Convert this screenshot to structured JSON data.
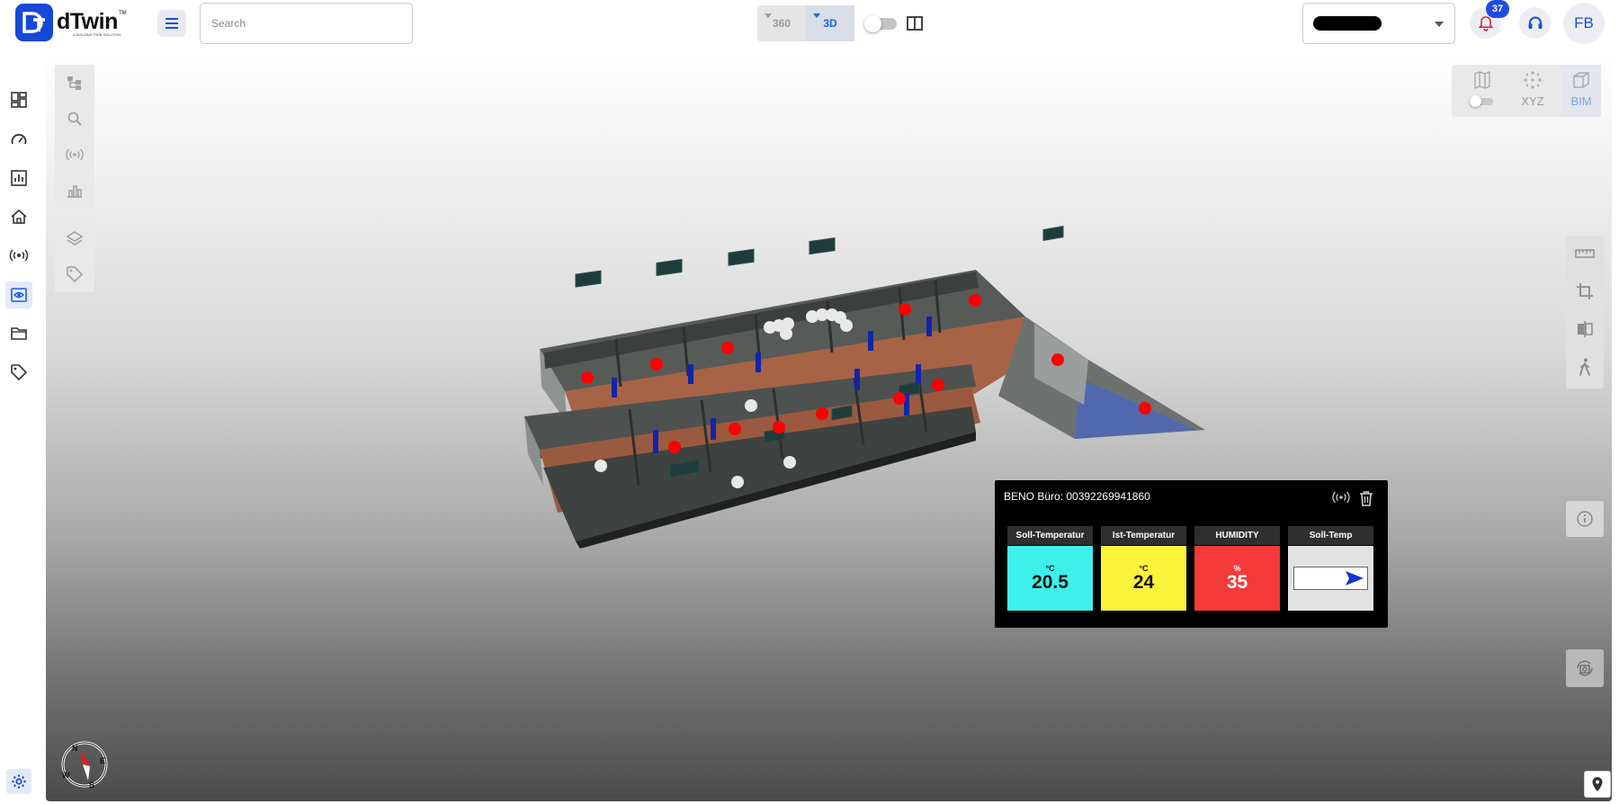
{
  "app": {
    "logo_text": "dTwin",
    "logo_tm": "TM",
    "logo_subtitle": "A BUILDING TWIN SOLUTION"
  },
  "header": {
    "search_placeholder": "Search",
    "view_modes": [
      {
        "label": "360",
        "active": false
      },
      {
        "label": "3D",
        "active": true
      }
    ],
    "notification_count": "37",
    "user_initials": "FB"
  },
  "sidebar": {
    "items": [
      {
        "icon": "dashboard-icon",
        "active": false
      },
      {
        "icon": "speedometer-icon",
        "active": false
      },
      {
        "icon": "report-chart-icon",
        "active": false
      },
      {
        "icon": "building-icon",
        "active": false
      },
      {
        "icon": "sensor-icon",
        "active": false
      },
      {
        "icon": "digital-twin-view-icon",
        "active": true
      },
      {
        "icon": "folder-icon",
        "active": false
      },
      {
        "icon": "tag-icon",
        "active": false
      }
    ]
  },
  "viewer": {
    "bim_options": [
      {
        "label": "",
        "icon": "floor-plan-icon"
      },
      {
        "label": "XYZ",
        "icon": "xyz-points-icon"
      },
      {
        "label": "BIM",
        "icon": "bim-cube-icon",
        "active": true
      }
    ],
    "compass": {
      "n": "N",
      "e": "E",
      "s": "S",
      "w": "W"
    }
  },
  "popup": {
    "title": "BENO Büro: 00392269941860",
    "cards": [
      {
        "header": "Soll-Temperatur",
        "unit": "°C",
        "value": "20.5",
        "color": "#3ff0ea"
      },
      {
        "header": "Ist-Temperatur",
        "unit": "°C",
        "value": "24",
        "color": "#fbf23c"
      },
      {
        "header": "HUMIDITY",
        "unit": "%",
        "value": "35",
        "color": "#f43a3a"
      },
      {
        "header": "Soll-Temp",
        "unit": "",
        "value": "",
        "color": "#e2e2e2"
      }
    ]
  },
  "colors": {
    "brand": "#1549d6",
    "sensor_alarm": "#ff0000",
    "sensor_idle": "#e8e8e8"
  }
}
